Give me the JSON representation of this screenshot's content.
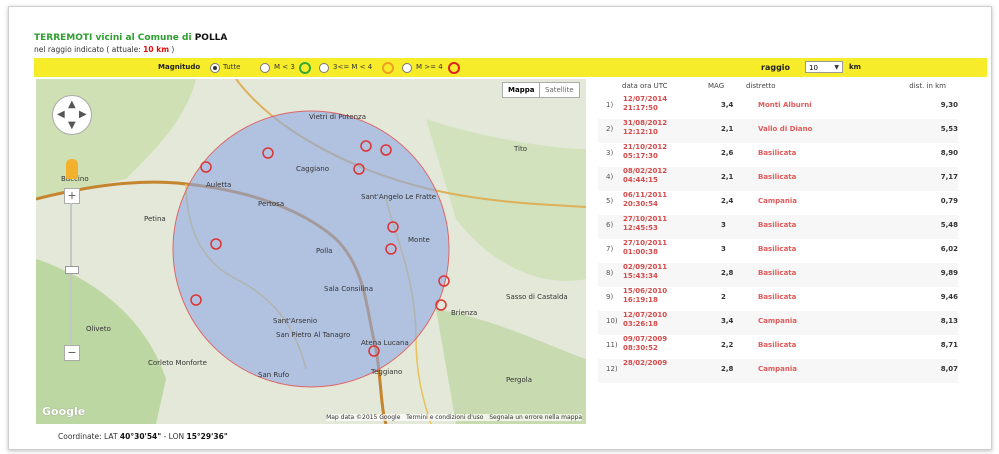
{
  "header": {
    "title_green": "TERREMOTI vicini al Comune di",
    "title_town": "POLLA",
    "subtitle_prefix": "nel raggio indicato ( attuale:",
    "subtitle_value": "10 km",
    "subtitle_suffix": ")"
  },
  "filter": {
    "magnitude_label": "Magnitudo",
    "options": [
      "Tutte",
      "M < 3",
      "3<= M < 4",
      "M >= 4"
    ],
    "selected": "Tutte",
    "raggio_label": "raggio",
    "raggio_value": "10",
    "raggio_unit": "km"
  },
  "map": {
    "type_buttons": [
      "Mappa",
      "Satellite"
    ],
    "footer_data": "Map data ©2015 Google",
    "footer_terms": "Termini e condizioni d'uso",
    "footer_report": "Segnala un errore nella mappa",
    "logo": "Google",
    "places": [
      "Vietri di Potenza",
      "Caggiano",
      "Auletta",
      "Pertosa",
      "Sant'Angelo Le Fratte",
      "Petina",
      "Polla",
      "Monte",
      "Sant'Arsenio",
      "San Pietro Al Tanagro",
      "Atena Lucana",
      "Sala Consilina",
      "Sasso di Castalda",
      "Brienza",
      "Tito",
      "Oliveto",
      "Corleto Monforte",
      "San Rufo",
      "Pergola",
      "Teggiano",
      "Buccino"
    ]
  },
  "coords": {
    "label": "Coordinate:",
    "lat_label": "LAT",
    "lat": "40°30'54\"",
    "sep": " - LON",
    "lon": "15°29'36\""
  },
  "list": {
    "headers": [
      "data ora UTC",
      "MAG",
      "distretto",
      "dist. in km"
    ],
    "rows": [
      {
        "n": "1)",
        "date": "12/07/2014",
        "time": "21:17:50",
        "mag": "3,4",
        "district": "Monti Alburni",
        "km": "9,30"
      },
      {
        "n": "2)",
        "date": "31/08/2012",
        "time": "12:12:10",
        "mag": "2,1",
        "district": "Vallo di Diano",
        "km": "5,53"
      },
      {
        "n": "3)",
        "date": "21/10/2012",
        "time": "05:17:30",
        "mag": "2,6",
        "district": "Basilicata",
        "km": "8,90"
      },
      {
        "n": "4)",
        "date": "08/02/2012",
        "time": "04:44:15",
        "mag": "2,1",
        "district": "Basilicata",
        "km": "7,17"
      },
      {
        "n": "5)",
        "date": "06/11/2011",
        "time": "20:30:54",
        "mag": "2,4",
        "district": "Campania",
        "km": "0,79"
      },
      {
        "n": "6)",
        "date": "27/10/2011",
        "time": "12:45:53",
        "mag": "3",
        "district": "Basilicata",
        "km": "5,48"
      },
      {
        "n": "7)",
        "date": "27/10/2011",
        "time": "01:00:38",
        "mag": "3",
        "district": "Basilicata",
        "km": "6,02"
      },
      {
        "n": "8)",
        "date": "02/09/2011",
        "time": "15:43:34",
        "mag": "2,8",
        "district": "Basilicata",
        "km": "9,89"
      },
      {
        "n": "9)",
        "date": "15/06/2010",
        "time": "16:19:18",
        "mag": "2",
        "district": "Basilicata",
        "km": "9,46"
      },
      {
        "n": "10)",
        "date": "12/07/2010",
        "time": "03:26:18",
        "mag": "3,4",
        "district": "Campania",
        "km": "8,13"
      },
      {
        "n": "11)",
        "date": "09/07/2009",
        "time": "08:30:52",
        "mag": "2,2",
        "district": "Basilicata",
        "km": "8,71"
      },
      {
        "n": "12)",
        "date": "28/02/2009",
        "time": "",
        "mag": "2,8",
        "district": "Campania",
        "km": "8,07"
      }
    ]
  },
  "colors": {
    "toolbar_bg": "#f7ec2a",
    "title_green": "#2e9e2e",
    "event_red": "#d44a4a",
    "circle_fill": "#8ea8e6"
  }
}
